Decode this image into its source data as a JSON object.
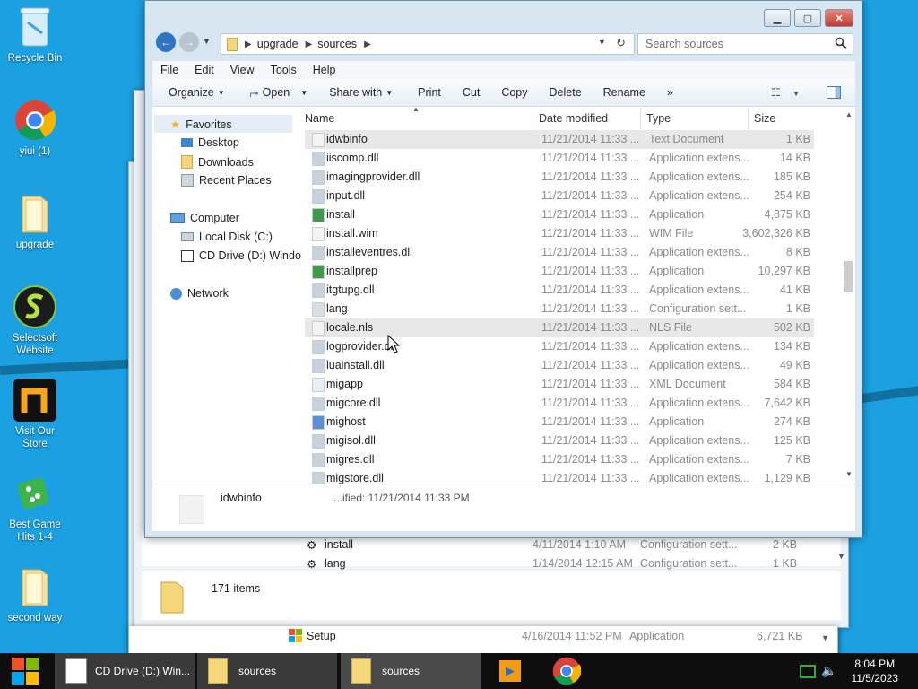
{
  "desktop": {
    "icons": [
      {
        "label": "Recycle Bin",
        "icon": "recycle-bin-icon"
      },
      {
        "label": "yiui (1)",
        "icon": "chrome-icon"
      },
      {
        "label": "upgrade",
        "icon": "folder-icon"
      },
      {
        "label": "Selectsoft Website",
        "icon": "selectsoft-icon"
      },
      {
        "label": "Visit Our Store",
        "icon": "store-icon"
      },
      {
        "label": "Best Game Hits 1-4",
        "icon": "dice-icon"
      },
      {
        "label": "second way",
        "icon": "folder-icon"
      }
    ]
  },
  "taskbar": {
    "apps": [
      {
        "label": "CD Drive (D:) Win...",
        "icon": "cd-drive-icon"
      },
      {
        "label": "sources",
        "icon": "folder-icon"
      },
      {
        "label": "sources",
        "icon": "folder-icon"
      }
    ],
    "time": "8:04 PM",
    "date": "11/5/2023"
  },
  "back_window": {
    "status_count": "171 items",
    "rows": [
      {
        "name": "install",
        "date": "4/11/2014 1:10 AM",
        "type": "Configuration sett...",
        "size": "2 KB"
      },
      {
        "name": "lang",
        "date": "1/14/2014 12:15 AM",
        "type": "Configuration sett...",
        "size": "1 KB"
      },
      {
        "name": "Setup",
        "date": "4/16/2014 11:52 PM",
        "type": "Application",
        "size": "6,721 KB"
      }
    ]
  },
  "explorer": {
    "breadcrumb": [
      "upgrade",
      "sources"
    ],
    "search_placeholder": "Search sources",
    "menu": [
      "File",
      "Edit",
      "View",
      "Tools",
      "Help"
    ],
    "commands": {
      "organize": "Organize",
      "open": "Open",
      "share": "Share with",
      "print": "Print",
      "cut": "Cut",
      "copy": "Copy",
      "delete": "Delete",
      "rename": "Rename",
      "more": "»"
    },
    "nav": {
      "favorites": "Favorites",
      "favorite_items": [
        "Desktop",
        "Downloads",
        "Recent Places"
      ],
      "computer": "Computer",
      "computer_items": [
        "Local Disk (C:)",
        "CD Drive (D:) Windo"
      ],
      "network": "Network"
    },
    "columns": {
      "name": "Name",
      "date": "Date modified",
      "type": "Type",
      "size": "Size"
    },
    "files": [
      {
        "name": "idwbinfo",
        "date": "11/21/2014 11:33 ...",
        "type": "Text Document",
        "size": "1 KB",
        "icon": "text-file-icon"
      },
      {
        "name": "iiscomp.dll",
        "date": "11/21/2014 11:33 ...",
        "type": "Application extens...",
        "size": "14 KB",
        "icon": "dll-file-icon"
      },
      {
        "name": "imagingprovider.dll",
        "date": "11/21/2014 11:33 ...",
        "type": "Application extens...",
        "size": "185 KB",
        "icon": "dll-file-icon"
      },
      {
        "name": "input.dll",
        "date": "11/21/2014 11:33 ...",
        "type": "Application extens...",
        "size": "254 KB",
        "icon": "dll-file-icon"
      },
      {
        "name": "install",
        "date": "11/21/2014 11:33 ...",
        "type": "Application",
        "size": "4,875 KB",
        "icon": "installer-icon"
      },
      {
        "name": "install.wim",
        "date": "11/21/2014 11:33 ...",
        "type": "WIM File",
        "size": "3,602,326 KB",
        "icon": "blank-file-icon"
      },
      {
        "name": "installeventres.dll",
        "date": "11/21/2014 11:33 ...",
        "type": "Application extens...",
        "size": "8 KB",
        "icon": "dll-file-icon"
      },
      {
        "name": "installprep",
        "date": "11/21/2014 11:33 ...",
        "type": "Application",
        "size": "10,297 KB",
        "icon": "installer-icon"
      },
      {
        "name": "itgtupg.dll",
        "date": "11/21/2014 11:33 ...",
        "type": "Application extens...",
        "size": "41 KB",
        "icon": "dll-file-icon"
      },
      {
        "name": "lang",
        "date": "11/21/2014 11:33 ...",
        "type": "Configuration sett...",
        "size": "1 KB",
        "icon": "config-file-icon"
      },
      {
        "name": "locale.nls",
        "date": "11/21/2014 11:33 ...",
        "type": "NLS File",
        "size": "502 KB",
        "icon": "blank-file-icon"
      },
      {
        "name": "logprovider.dll",
        "date": "11/21/2014 11:33 ...",
        "type": "Application extens...",
        "size": "134 KB",
        "icon": "dll-file-icon"
      },
      {
        "name": "luainstall.dll",
        "date": "11/21/2014 11:33 ...",
        "type": "Application extens...",
        "size": "49 KB",
        "icon": "dll-file-icon"
      },
      {
        "name": "migapp",
        "date": "11/21/2014 11:33 ...",
        "type": "XML Document",
        "size": "584 KB",
        "icon": "xml-file-icon"
      },
      {
        "name": "migcore.dll",
        "date": "11/21/2014 11:33 ...",
        "type": "Application extens...",
        "size": "7,642 KB",
        "icon": "dll-file-icon"
      },
      {
        "name": "mighost",
        "date": "11/21/2014 11:33 ...",
        "type": "Application",
        "size": "274 KB",
        "icon": "app-icon"
      },
      {
        "name": "migisol.dll",
        "date": "11/21/2014 11:33 ...",
        "type": "Application extens...",
        "size": "125 KB",
        "icon": "dll-file-icon"
      },
      {
        "name": "migres.dll",
        "date": "11/21/2014 11:33 ...",
        "type": "Application extens...",
        "size": "7 KB",
        "icon": "dll-file-icon"
      },
      {
        "name": "migstore.dll",
        "date": "11/21/2014 11:33 ...",
        "type": "Application extens...",
        "size": "1,129 KB",
        "icon": "dll-file-icon"
      }
    ],
    "details": {
      "name": "idwbinfo",
      "date_fragment": "...ified: 11/21/2014 11:33 PM"
    }
  }
}
